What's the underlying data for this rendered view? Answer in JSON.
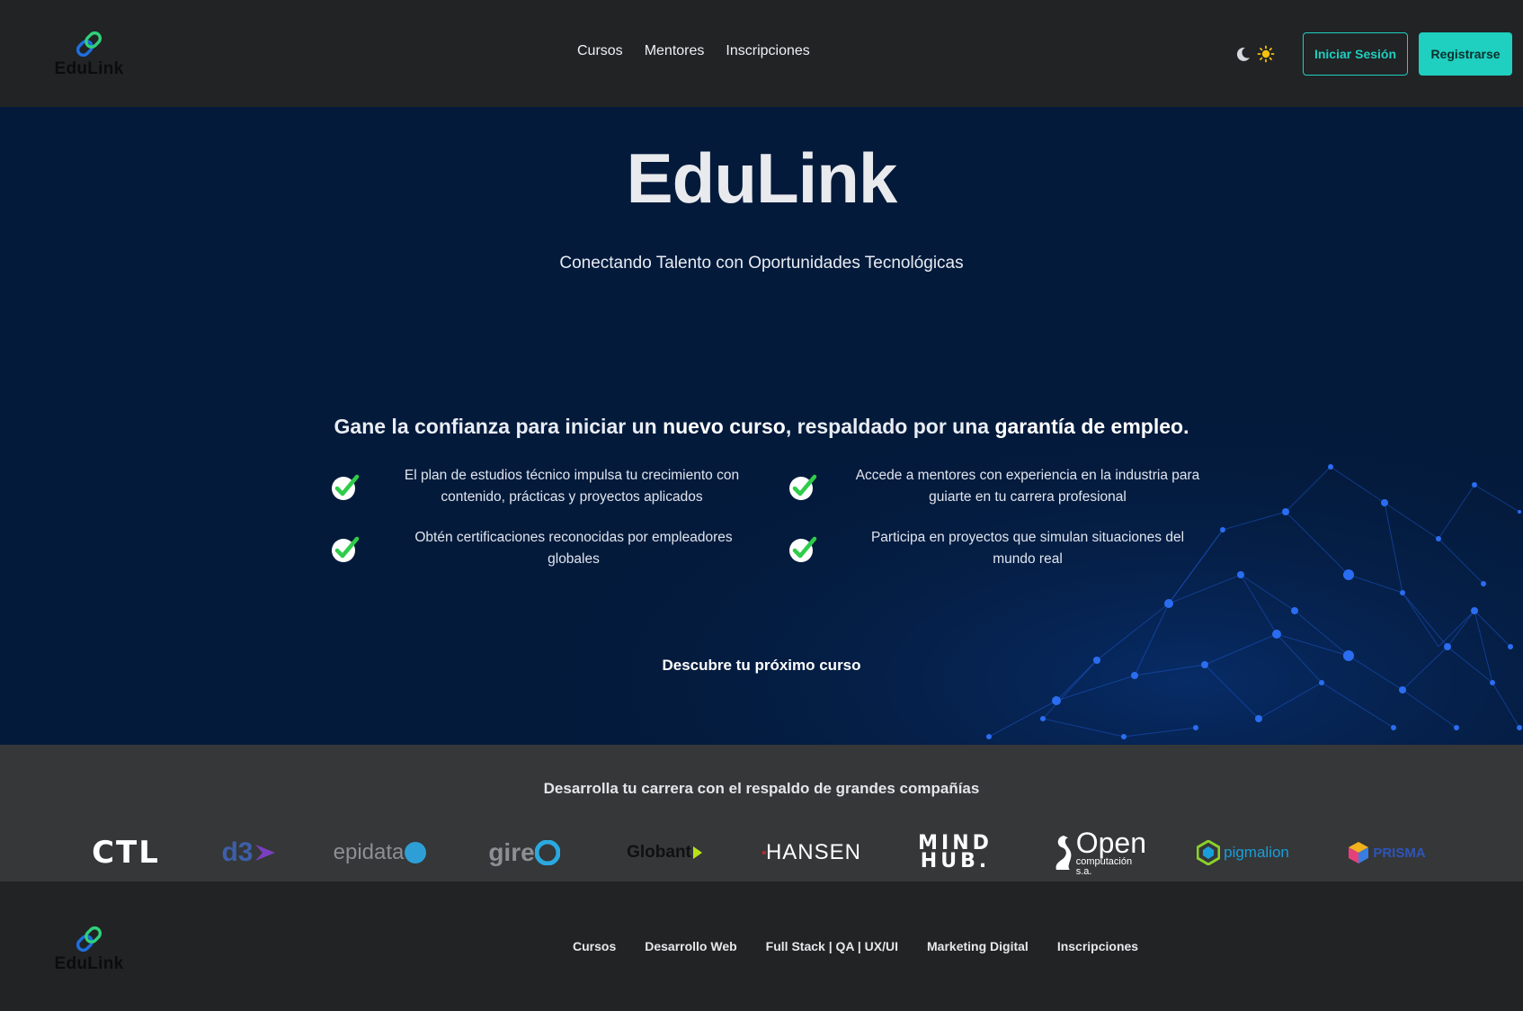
{
  "brand": {
    "name": "EduLink"
  },
  "nav": {
    "links": [
      "Cursos",
      "Mentores",
      "Inscripciones"
    ],
    "login_label": "Iniciar Sesión",
    "register_label": "Registrarse"
  },
  "hero": {
    "title": "EduLink",
    "subtitle": "Conectando Talento con Oportunidades Tecnológicas",
    "heading_pre": "Gane la confianza para iniciar un ",
    "heading_bold1": "nuevo curso",
    "heading_mid": ", respaldado por una ",
    "heading_bold2": "garantía de empleo.",
    "features": [
      "El plan de estudios técnico impulsa tu crecimiento con contenido, prácticas y proyectos aplicados",
      "Accede a mentores con experiencia en la industria para guiarte en tu carrera profesional",
      "Obtén certificaciones reconocidas por empleadores globales",
      "Participa en proyectos que simulan situaciones del mundo real"
    ],
    "cta": "Descubre tu próximo curso"
  },
  "partners": {
    "title": "Desarrolla tu carrera con el respaldo de grandes compañías",
    "logos": [
      {
        "text": "CTL"
      },
      {
        "text": "d3"
      },
      {
        "text": "epidata"
      },
      {
        "text": "gire"
      },
      {
        "text": "Globant"
      },
      {
        "text": "HANSEN"
      },
      {
        "text": "MIND",
        "text2": "HUB."
      },
      {
        "text": "Open",
        "text2": "computación s.a."
      },
      {
        "text": "pigmalion"
      },
      {
        "text": "PRISMA"
      }
    ]
  },
  "footer": {
    "links": [
      "Cursos",
      "Desarrollo Web",
      "Full Stack | QA | UX/UI",
      "Marketing Digital",
      "Inscripciones"
    ]
  },
  "colors": {
    "accent": "#1fcfbf",
    "hero_bg": "#041a3b",
    "nav_bg": "#212325",
    "partners_bg": "#353739",
    "check_green": "#2fcc4a"
  }
}
